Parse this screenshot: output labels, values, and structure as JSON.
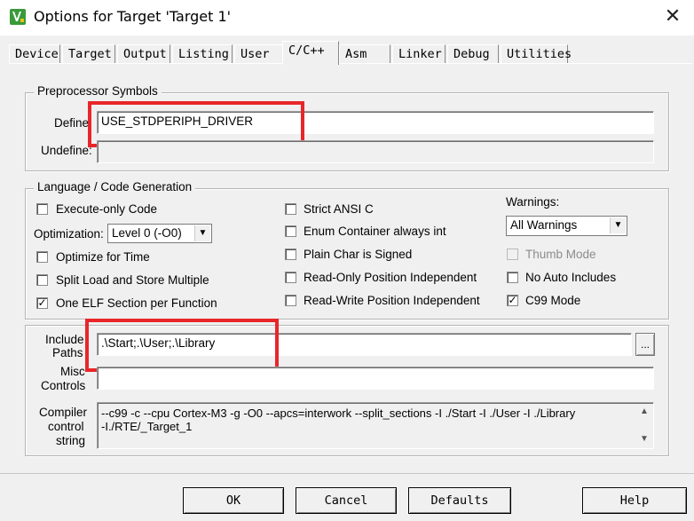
{
  "window": {
    "title": "Options for Target 'Target 1'",
    "app_icon": "keil-uvision-icon",
    "close": "✕"
  },
  "tabs": [
    {
      "label": "Device"
    },
    {
      "label": "Target"
    },
    {
      "label": "Output"
    },
    {
      "label": "Listing"
    },
    {
      "label": "User"
    },
    {
      "label": "C/C++",
      "active": true
    },
    {
      "label": "Asm"
    },
    {
      "label": "Linker"
    },
    {
      "label": "Debug"
    },
    {
      "label": "Utilities"
    }
  ],
  "preprocessor": {
    "group_title": "Preprocessor Symbols",
    "define_label": "Define:",
    "define_value": "USE_STDPERIPH_DRIVER",
    "undefine_label": "Undefine:",
    "undefine_value": ""
  },
  "language": {
    "group_title": "Language / Code Generation",
    "execute_only": {
      "label": "Execute-only Code",
      "checked": false
    },
    "optimization_label": "Optimization:",
    "optimization_value": "Level 0 (-O0)",
    "optimize_time": {
      "label": "Optimize for Time",
      "checked": false
    },
    "split_load_store": {
      "label": "Split Load and Store Multiple",
      "checked": false
    },
    "one_elf": {
      "label": "One ELF Section per Function",
      "checked": true
    },
    "strict_ansi": {
      "label": "Strict ANSI C",
      "checked": false
    },
    "enum_container": {
      "label": "Enum Container always int",
      "checked": false
    },
    "plain_char": {
      "label": "Plain Char is Signed",
      "checked": false
    },
    "ro_pi": {
      "label": "Read-Only Position Independent",
      "checked": false
    },
    "rw_pi": {
      "label": "Read-Write Position Independent",
      "checked": false
    },
    "warnings_label": "Warnings:",
    "warnings_value": "All Warnings",
    "thumb_mode": {
      "label": "Thumb Mode",
      "checked": false,
      "disabled": true
    },
    "no_auto_includes": {
      "label": "No Auto Includes",
      "checked": false
    },
    "c99_mode": {
      "label": "C99 Mode",
      "checked": true
    }
  },
  "include": {
    "label_line1": "Include",
    "label_line2": "Paths",
    "value": ".\\Start;.\\User;.\\Library",
    "browse": "..."
  },
  "misc": {
    "label_line1": "Misc",
    "label_line2": "Controls",
    "value": ""
  },
  "compiler": {
    "label_line1": "Compiler",
    "label_line2": "control",
    "label_line3": "string",
    "line1": "--c99 -c --cpu Cortex-M3 -g -O0 --apcs=interwork --split_sections -I ./Start -I ./User -I ./Library",
    "line2": "-I./RTE/_Target_1"
  },
  "buttons": {
    "ok": "OK",
    "cancel": "Cancel",
    "defaults": "Defaults",
    "help": "Help"
  },
  "colors": {
    "highlight_box": "#e8262a",
    "dialog_bg": "#f0f0f0"
  }
}
